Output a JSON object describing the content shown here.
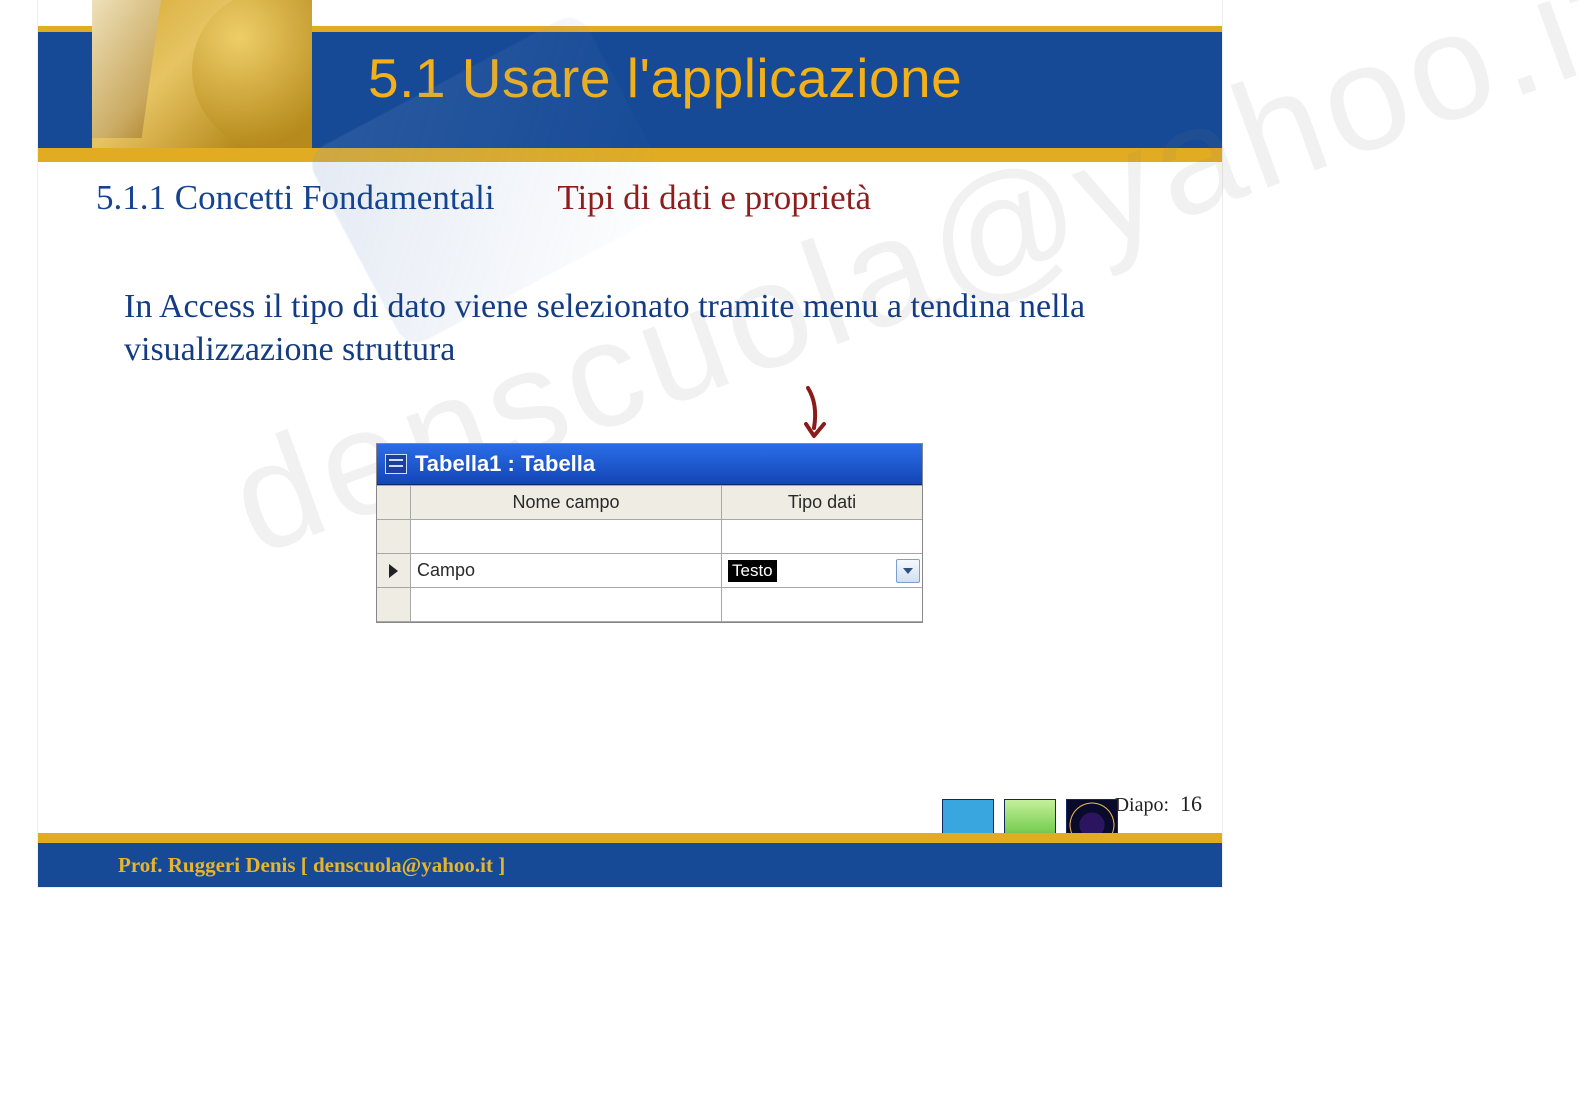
{
  "header": {
    "title": "5.1 Usare l'applicazione"
  },
  "subhead": {
    "left": "5.1.1 Concetti Fondamentali",
    "right": "Tipi di dati e proprietà"
  },
  "body": {
    "paragraph": "In Access il tipo di dato viene selezionato tramite menu a tendina nella visualizzazione struttura"
  },
  "access_window": {
    "title": "Tabella1 : Tabella",
    "columns": {
      "c1": "Nome campo",
      "c2": "Tipo dati"
    },
    "rows": [
      {
        "name": "",
        "type": ""
      },
      {
        "name": "Campo",
        "type": "Testo"
      }
    ]
  },
  "watermark": "denscuola@yahoo.it",
  "footer": {
    "author": "Prof. Ruggeri Denis  [ denscuola@yahoo.it ]",
    "diapo_label": "Diapo:",
    "diapo_number": "16"
  }
}
